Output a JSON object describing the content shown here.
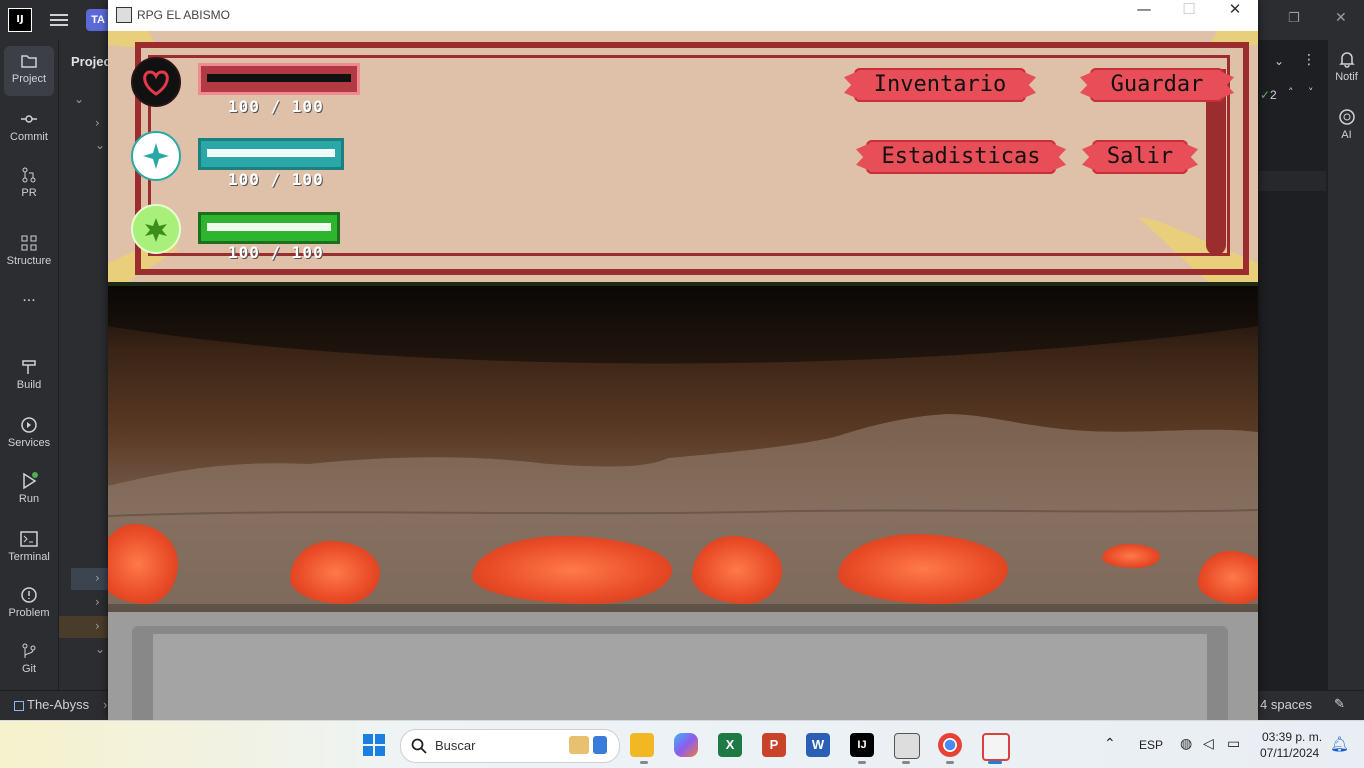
{
  "ide": {
    "logo": "IJ",
    "project_chip": "TA",
    "panel_title": "Projec",
    "tools": [
      {
        "label": "Project",
        "icon": "folder-icon"
      },
      {
        "label": "Commit",
        "icon": "commit-icon"
      },
      {
        "label": "PR",
        "icon": "pull-request-icon"
      },
      {
        "label": "Structure",
        "icon": "structure-icon"
      },
      {
        "label": "...",
        "icon": "more-icon"
      },
      {
        "label": "Build",
        "icon": "hammer-icon"
      },
      {
        "label": "Services",
        "icon": "services-icon"
      },
      {
        "label": "Run",
        "icon": "run-icon"
      },
      {
        "label": "Terminal",
        "icon": "terminal-icon"
      },
      {
        "label": "Problem",
        "icon": "problem-icon"
      },
      {
        "label": "Git",
        "icon": "git-icon"
      }
    ],
    "right_tools": [
      {
        "label": "Notif",
        "icon": "bell-icon"
      },
      {
        "label": "AI",
        "icon": "ai-icon"
      }
    ],
    "inspection_count": "2",
    "status": {
      "project": "The-Abyss",
      "indent": "4 spaces"
    }
  },
  "window": {
    "title": "RPG EL ABISMO",
    "controls": {
      "minimize": "—",
      "maximize": "☐",
      "close": "✕"
    }
  },
  "hud": {
    "stats": [
      {
        "name": "health",
        "icon": "heart-icon",
        "text": "100 / 100",
        "fraction": 1.0,
        "color": "#c33a42"
      },
      {
        "name": "mana",
        "icon": "sparkle-icon",
        "text": "100 / 100",
        "fraction": 1.0,
        "color": "#2aa8a8"
      },
      {
        "name": "stamina",
        "icon": "star-badge-icon",
        "text": "100 / 100",
        "fraction": 1.0,
        "color": "#2db52d"
      }
    ],
    "buttons": {
      "inventory": "Inventario",
      "save": "Guardar",
      "stats": "Estadisticas",
      "exit": "Salir"
    }
  },
  "taskbar": {
    "search_placeholder": "Buscar",
    "language": "ESP",
    "time": "03:39 p. m.",
    "date": "07/11/2024"
  }
}
